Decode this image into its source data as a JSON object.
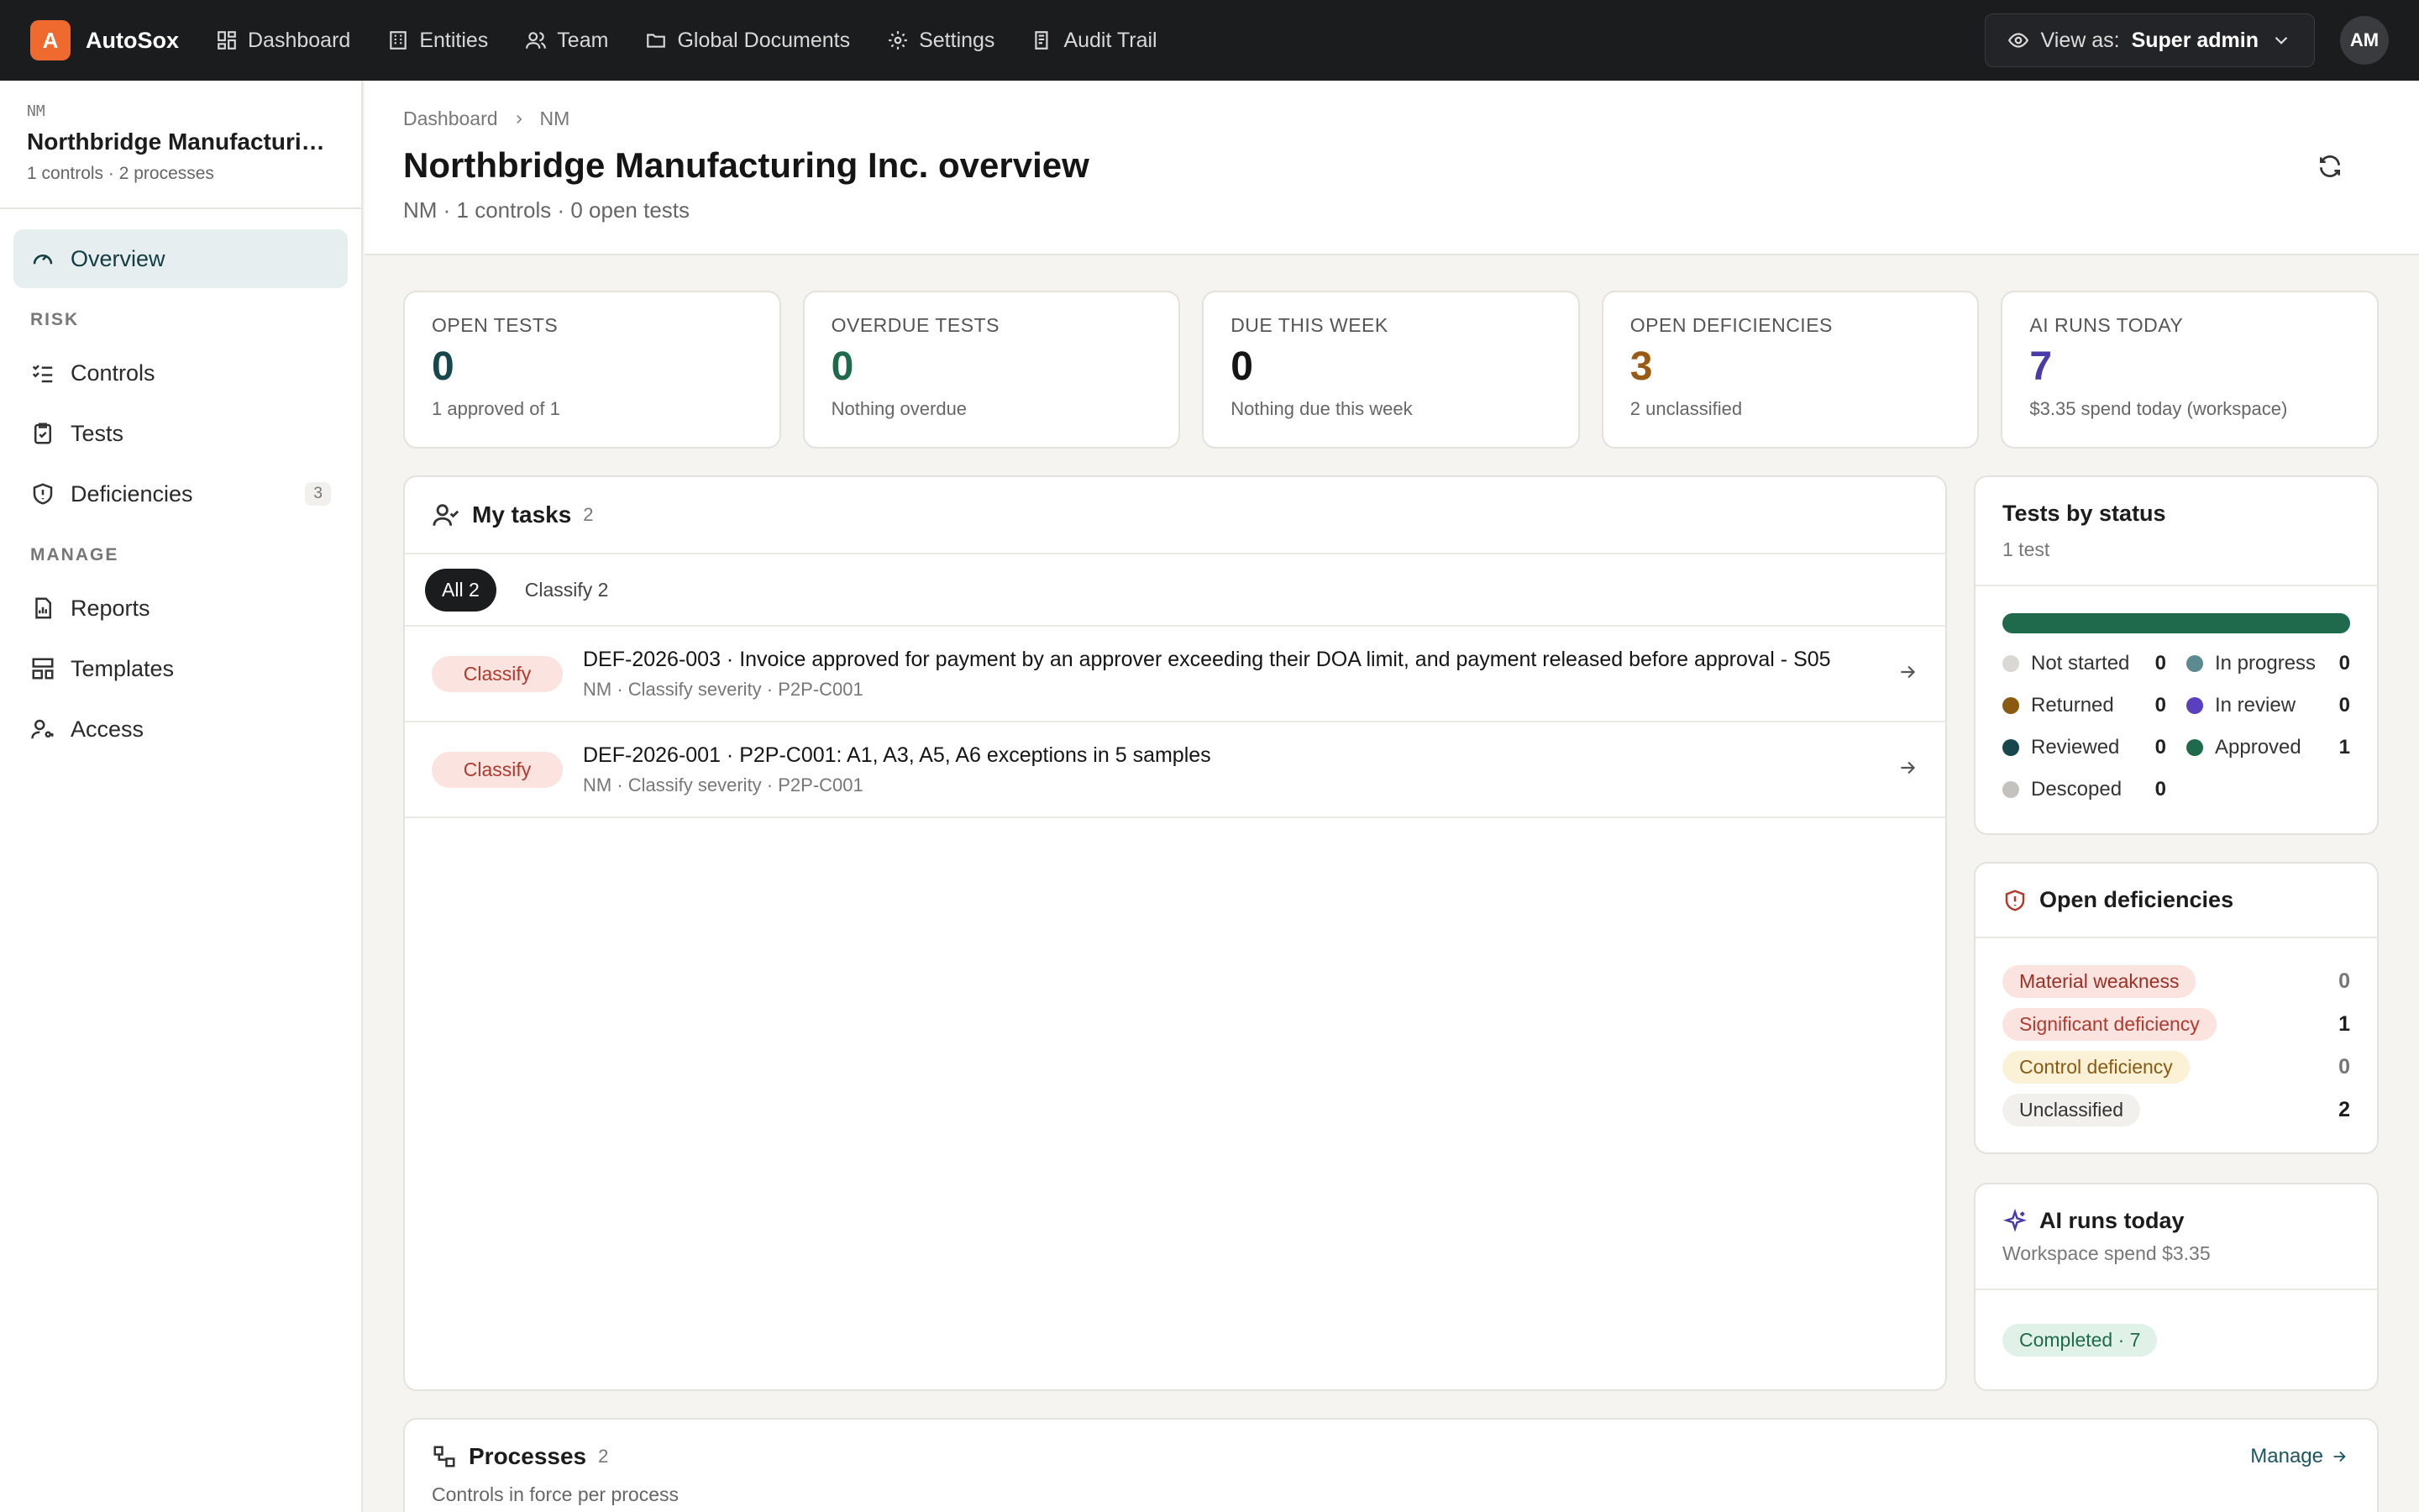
{
  "app": {
    "logo_letter": "A",
    "name": "AutoSox"
  },
  "nav": [
    {
      "label": "Dashboard",
      "icon": "dashboard-icon"
    },
    {
      "label": "Entities",
      "icon": "building-icon"
    },
    {
      "label": "Team",
      "icon": "users-icon"
    },
    {
      "label": "Global Documents",
      "icon": "folder-icon"
    },
    {
      "label": "Settings",
      "icon": "gear-icon"
    },
    {
      "label": "Audit Trail",
      "icon": "audit-icon"
    }
  ],
  "view_as": {
    "label": "View as:",
    "value": "Super admin"
  },
  "user": {
    "initials": "AM"
  },
  "sidebar": {
    "code": "NM",
    "title": "Northbridge Manufacturing Inc.",
    "subtitle": "1 controls · 2 processes",
    "overview": "Overview",
    "risk_section": "RISK",
    "controls": "Controls",
    "tests": "Tests",
    "deficiencies": "Deficiencies",
    "deficiencies_count": "3",
    "manage_section": "MANAGE",
    "reports": "Reports",
    "templates": "Templates",
    "access": "Access"
  },
  "header": {
    "breadcrumb": [
      "Dashboard",
      "NM"
    ],
    "title": "Northbridge Manufacturing Inc. overview",
    "subtitle": "NM · 1 controls · 0 open tests"
  },
  "kpis": [
    {
      "label": "OPEN TESTS",
      "value": "0",
      "note": "1 approved of 1",
      "color": "#17464d"
    },
    {
      "label": "OVERDUE TESTS",
      "value": "0",
      "note": "Nothing overdue",
      "color": "#1f6a4d"
    },
    {
      "label": "DUE THIS WEEK",
      "value": "0",
      "note": "Nothing due this week",
      "color": "#151515"
    },
    {
      "label": "OPEN DEFICIENCIES",
      "value": "3",
      "note": "2 unclassified",
      "color": "#9a5a12"
    },
    {
      "label": "AI RUNS TODAY",
      "value": "7",
      "note": "$3.35 spend today (workspace)",
      "color": "#4a3aa8"
    }
  ],
  "tasks": {
    "title": "My tasks",
    "count": "2",
    "filters": [
      "All 2",
      "Classify 2"
    ],
    "rows": [
      {
        "tag": "Classify",
        "main": "DEF-2026-003 · Invoice approved for payment by an approver exceeding their DOA limit, and payment released before approval - S05",
        "meta": "NM · Classify severity · P2P-C001"
      },
      {
        "tag": "Classify",
        "main": "DEF-2026-001 · P2P-C001: A1, A3, A5, A6 exceptions in 5 samples",
        "meta": "NM · Classify severity · P2P-C001"
      }
    ]
  },
  "tests_by_status": {
    "title": "Tests by status",
    "subtitle": "1 test",
    "approved_fraction": 1.0,
    "bar_color": "#1f6a4d",
    "items": [
      {
        "name": "Not started",
        "count": "0",
        "color": "#d9d8d4"
      },
      {
        "name": "In progress",
        "count": "0",
        "color": "#5b8a90"
      },
      {
        "name": "Returned",
        "count": "0",
        "color": "#8a5a12"
      },
      {
        "name": "In review",
        "count": "0",
        "color": "#5a3fc0"
      },
      {
        "name": "Reviewed",
        "count": "0",
        "color": "#17464d"
      },
      {
        "name": "Approved",
        "count": "1",
        "color": "#1f6a4d"
      },
      {
        "name": "Descoped",
        "count": "0",
        "color": "#c3c2be"
      }
    ]
  },
  "open_deficiencies": {
    "title": "Open deficiencies",
    "items": [
      {
        "name": "Material weakness",
        "count": "0",
        "bg": "#fbe3e0",
        "fg": "#9c2f24"
      },
      {
        "name": "Significant deficiency",
        "count": "1",
        "bg": "#fbe3e0",
        "fg": "#b03a2e"
      },
      {
        "name": "Control deficiency",
        "count": "0",
        "bg": "#fbf1d6",
        "fg": "#8a5a12"
      },
      {
        "name": "Unclassified",
        "count": "2",
        "bg": "#f1f0ec",
        "fg": "#333333"
      }
    ]
  },
  "ai_runs": {
    "title": "AI runs today",
    "subtitle": "Workspace spend $3.35",
    "badge": "Completed · 7"
  },
  "processes": {
    "title": "Processes",
    "count": "2",
    "subtitle": "Controls in force per process",
    "manage": "Manage"
  }
}
